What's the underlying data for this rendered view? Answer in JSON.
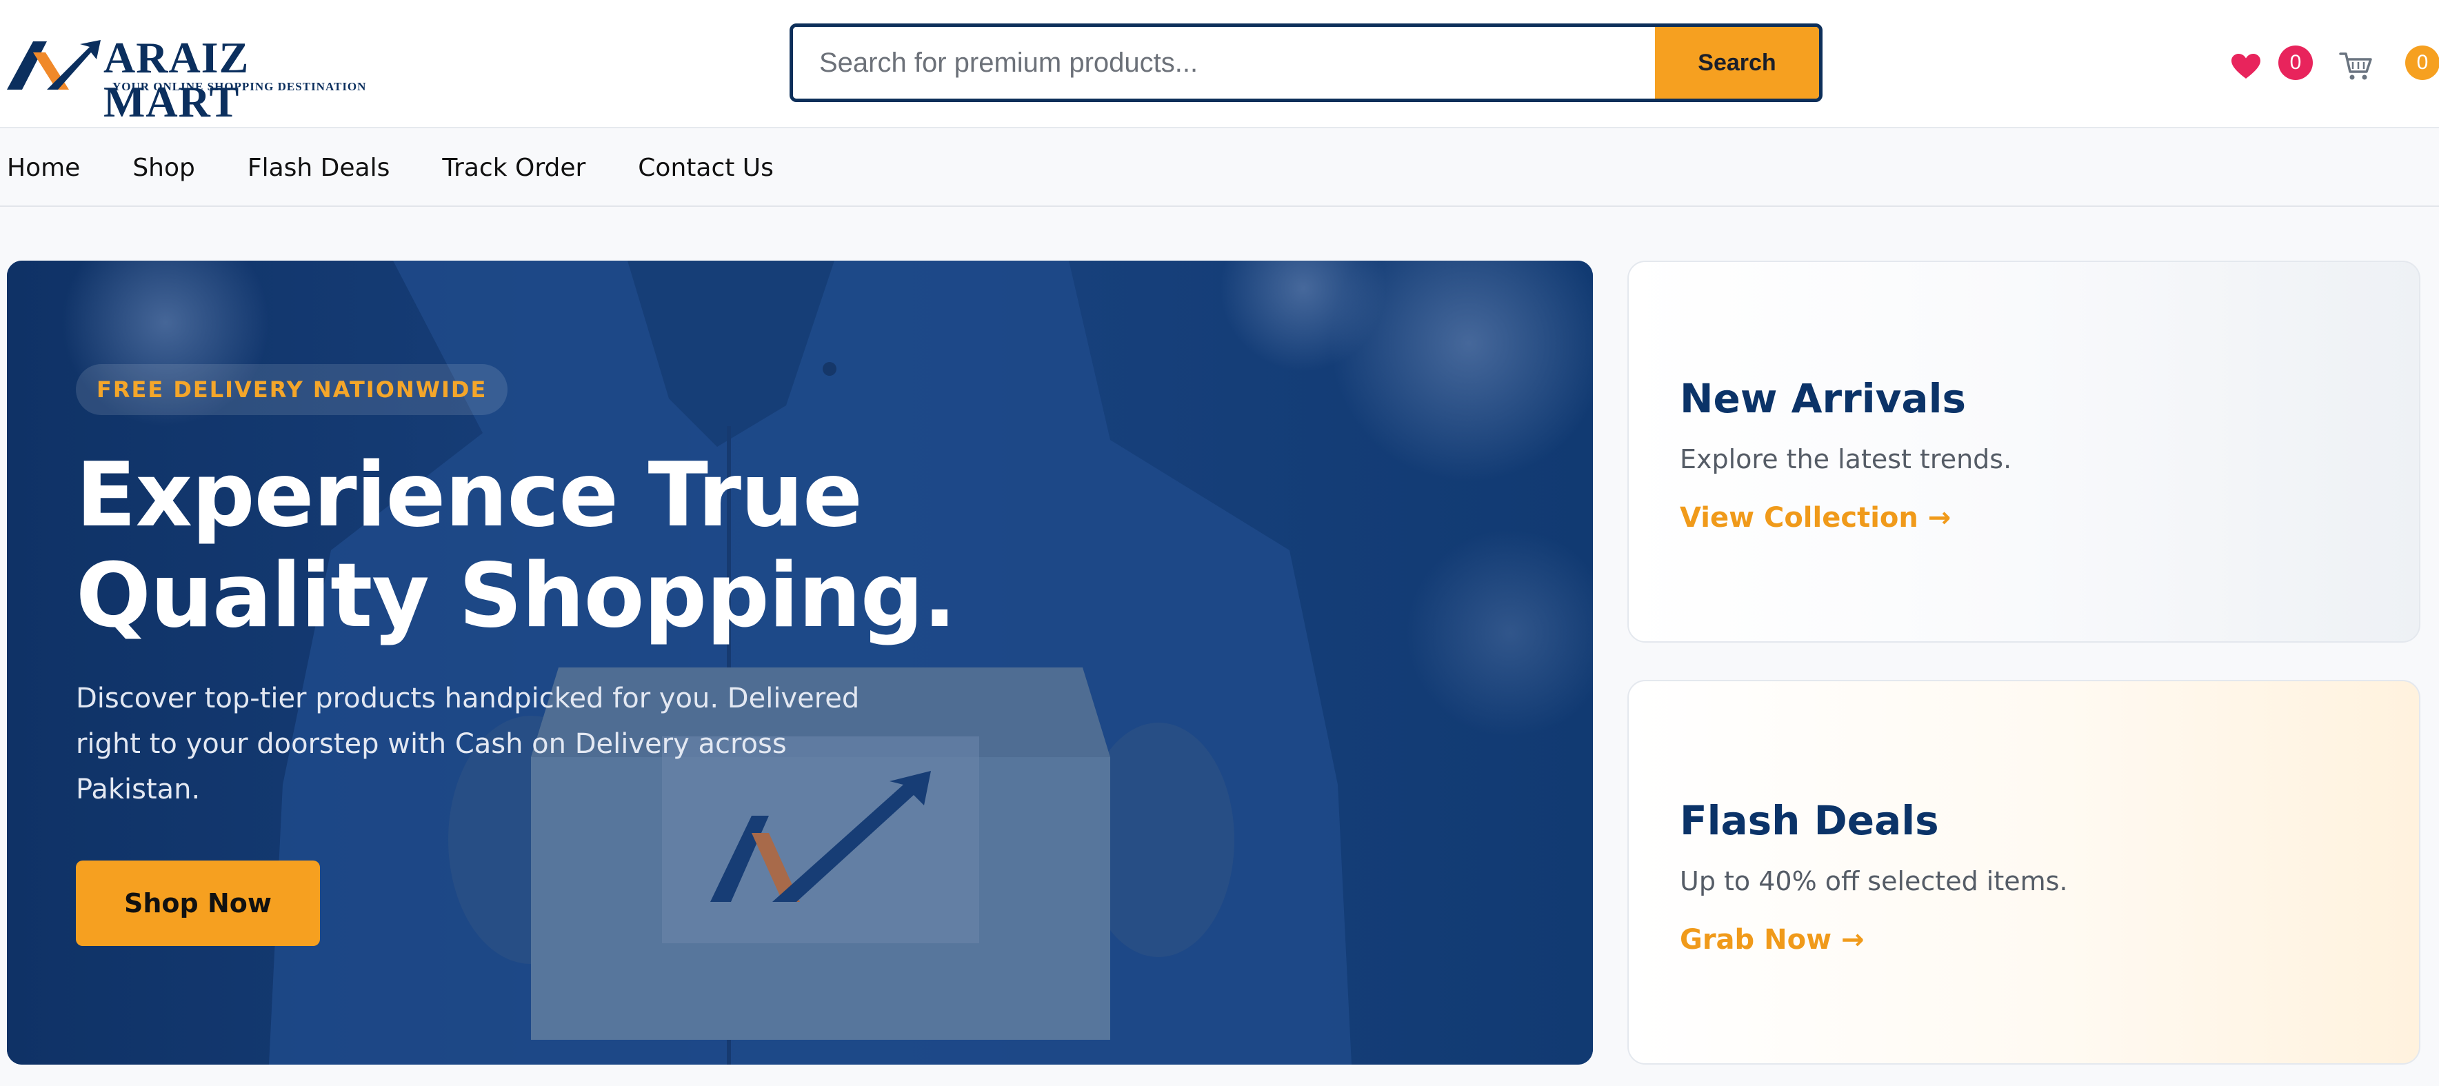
{
  "brand": {
    "name": "ARAIZ MART",
    "tagline": "YOUR ONLINE SHOPPING DESTINATION",
    "colors": {
      "navy": "#0b2f5e",
      "orange": "#f6a020",
      "pink": "#e8245c"
    }
  },
  "header": {
    "search": {
      "placeholder": "Search for premium products...",
      "value": "",
      "button_label": "Search"
    },
    "wishlist": {
      "icon": "heart-icon",
      "count": "0"
    },
    "cart": {
      "icon": "cart-icon",
      "count": "0"
    }
  },
  "nav": {
    "items": [
      {
        "label": "Home"
      },
      {
        "label": "Shop"
      },
      {
        "label": "Flash Deals"
      },
      {
        "label": "Track Order"
      },
      {
        "label": "Contact Us"
      }
    ]
  },
  "hero": {
    "badge": "FREE DELIVERY NATIONWIDE",
    "title": "Experience True Quality Shopping.",
    "text": "Discover top-tier products handpicked for you. Delivered right to your doorstep with Cash on Delivery across Pakistan.",
    "button_label": "Shop Now",
    "box_logo": "Araiz Mart"
  },
  "promos": [
    {
      "title": "New Arrivals",
      "subtitle": "Explore the latest trends.",
      "link_label": "View Collection →"
    },
    {
      "title": "Flash Deals",
      "subtitle": "Up to 40% off selected items.",
      "link_label": "Grab Now →"
    }
  ]
}
